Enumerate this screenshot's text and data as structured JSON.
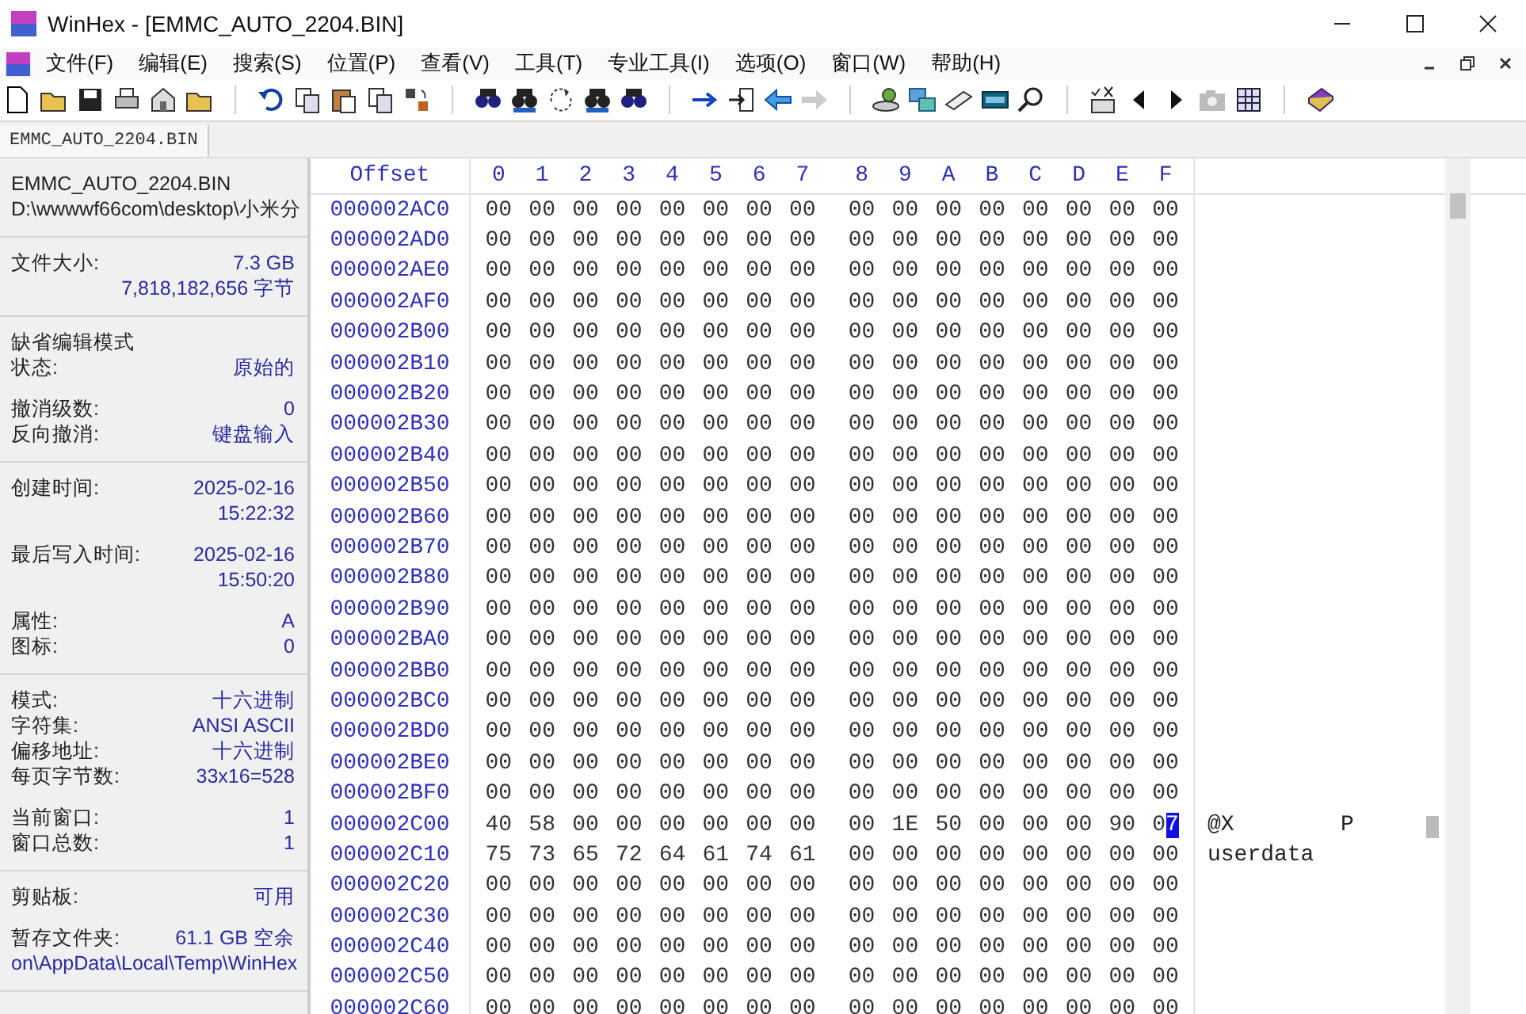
{
  "window": {
    "title": "WinHex - [EMMC_AUTO_2204.BIN]"
  },
  "menu": [
    "文件(F)",
    "编辑(E)",
    "搜索(S)",
    "位置(P)",
    "查看(V)",
    "工具(T)",
    "专业工具(I)",
    "选项(O)",
    "窗口(W)",
    "帮助(H)"
  ],
  "tabs": [
    {
      "label": "EMMC_AUTO_2204.BIN",
      "selected": true
    }
  ],
  "info_panel": [
    [
      [
        {
          "kind": "note",
          "label": "EMMC_AUTO_2204.BIN"
        },
        {
          "kind": "note",
          "label": "D:\\wwwwf66com\\desktop\\小米分"
        }
      ]
    ],
    [
      [
        {
          "kind": "pair",
          "label": "文件大小:",
          "value": "7.3 GB"
        },
        {
          "kind": "value",
          "value": "7,818,182,656 字节"
        }
      ]
    ],
    [
      [
        {
          "kind": "note",
          "label": "缺省编辑模式"
        },
        {
          "kind": "pair",
          "label": "状态:",
          "value": "原始的"
        }
      ],
      [
        {
          "kind": "pair",
          "label": "撤消级数:",
          "value": "0"
        },
        {
          "kind": "pair",
          "label": "反向撤消:",
          "value": "键盘输入"
        }
      ]
    ],
    [
      [
        {
          "kind": "pair",
          "label": "创建时间:",
          "value": "2025-02-16"
        },
        {
          "kind": "value",
          "value": "15:22:32"
        }
      ],
      [
        {
          "kind": "pair",
          "label": "最后写入时间:",
          "value": "2025-02-16"
        },
        {
          "kind": "value",
          "value": "15:50:20"
        }
      ],
      [
        {
          "kind": "pair",
          "label": "属性:",
          "value": "A"
        },
        {
          "kind": "pair",
          "label": "图标:",
          "value": "0"
        }
      ]
    ],
    [
      [
        {
          "kind": "pair",
          "label": "模式:",
          "value": "十六进制"
        },
        {
          "kind": "pair",
          "label": "字符集:",
          "value": "ANSI ASCII"
        },
        {
          "kind": "pair",
          "label": "偏移地址:",
          "value": "十六进制"
        },
        {
          "kind": "pair",
          "label": "每页字节数:",
          "value": "33x16=528"
        }
      ],
      [
        {
          "kind": "pair",
          "label": "当前窗口:",
          "value": "1"
        },
        {
          "kind": "pair",
          "label": "窗口总数:",
          "value": "1"
        }
      ]
    ],
    [
      [
        {
          "kind": "pair",
          "label": "剪贴板:",
          "value": "可用"
        }
      ],
      [
        {
          "kind": "pair",
          "label": "暂存文件夹:",
          "value": "61.1 GB 空余"
        },
        {
          "kind": "path",
          "value": "on\\AppData\\Local\\Temp\\WinHex"
        }
      ]
    ]
  ],
  "hex_view": {
    "offset_header": "Offset",
    "columns": [
      "0",
      "1",
      "2",
      "3",
      "4",
      "5",
      "6",
      "7",
      "8",
      "9",
      "A",
      "B",
      "C",
      "D",
      "E",
      "F"
    ],
    "rows": [
      {
        "offset": "000002AC0",
        "bytes": "00 00 00 00 00 00 00 00 00 00 00 00 00 00 00 00"
      },
      {
        "offset": "000002AD0",
        "bytes": "00 00 00 00 00 00 00 00 00 00 00 00 00 00 00 00"
      },
      {
        "offset": "000002AE0",
        "bytes": "00 00 00 00 00 00 00 00 00 00 00 00 00 00 00 00"
      },
      {
        "offset": "000002AF0",
        "bytes": "00 00 00 00 00 00 00 00 00 00 00 00 00 00 00 00"
      },
      {
        "offset": "000002B00",
        "bytes": "00 00 00 00 00 00 00 00 00 00 00 00 00 00 00 00"
      },
      {
        "offset": "000002B10",
        "bytes": "00 00 00 00 00 00 00 00 00 00 00 00 00 00 00 00"
      },
      {
        "offset": "000002B20",
        "bytes": "00 00 00 00 00 00 00 00 00 00 00 00 00 00 00 00"
      },
      {
        "offset": "000002B30",
        "bytes": "00 00 00 00 00 00 00 00 00 00 00 00 00 00 00 00"
      },
      {
        "offset": "000002B40",
        "bytes": "00 00 00 00 00 00 00 00 00 00 00 00 00 00 00 00"
      },
      {
        "offset": "000002B50",
        "bytes": "00 00 00 00 00 00 00 00 00 00 00 00 00 00 00 00"
      },
      {
        "offset": "000002B60",
        "bytes": "00 00 00 00 00 00 00 00 00 00 00 00 00 00 00 00"
      },
      {
        "offset": "000002B70",
        "bytes": "00 00 00 00 00 00 00 00 00 00 00 00 00 00 00 00"
      },
      {
        "offset": "000002B80",
        "bytes": "00 00 00 00 00 00 00 00 00 00 00 00 00 00 00 00"
      },
      {
        "offset": "000002B90",
        "bytes": "00 00 00 00 00 00 00 00 00 00 00 00 00 00 00 00"
      },
      {
        "offset": "000002BA0",
        "bytes": "00 00 00 00 00 00 00 00 00 00 00 00 00 00 00 00"
      },
      {
        "offset": "000002BB0",
        "bytes": "00 00 00 00 00 00 00 00 00 00 00 00 00 00 00 00"
      },
      {
        "offset": "000002BC0",
        "bytes": "00 00 00 00 00 00 00 00 00 00 00 00 00 00 00 00"
      },
      {
        "offset": "000002BD0",
        "bytes": "00 00 00 00 00 00 00 00 00 00 00 00 00 00 00 00"
      },
      {
        "offset": "000002BE0",
        "bytes": "00 00 00 00 00 00 00 00 00 00 00 00 00 00 00 00"
      },
      {
        "offset": "000002BF0",
        "bytes": "00 00 00 00 00 00 00 00 00 00 00 00 00 00 00 00"
      },
      {
        "offset": "000002C00",
        "bytes": "40 58 00 00 00 00 00 00 00 1E 50 00 00 00 90 07",
        "text": "@X        P",
        "cursor": true
      },
      {
        "offset": "000002C10",
        "bytes": "75 73 65 72 64 61 74 61 00 00 00 00 00 00 00 00",
        "text": "userdata"
      },
      {
        "offset": "000002C20",
        "bytes": "00 00 00 00 00 00 00 00 00 00 00 00 00 00 00 00"
      },
      {
        "offset": "000002C30",
        "bytes": "00 00 00 00 00 00 00 00 00 00 00 00 00 00 00 00"
      },
      {
        "offset": "000002C40",
        "bytes": "00 00 00 00 00 00 00 00 00 00 00 00 00 00 00 00"
      },
      {
        "offset": "000002C50",
        "bytes": "00 00 00 00 00 00 00 00 00 00 00 00 00 00 00 00"
      },
      {
        "offset": "000002C60",
        "bytes": "00 00 00 00 00 00 00 00 00 00 00 00 00 00 00 00"
      }
    ]
  }
}
